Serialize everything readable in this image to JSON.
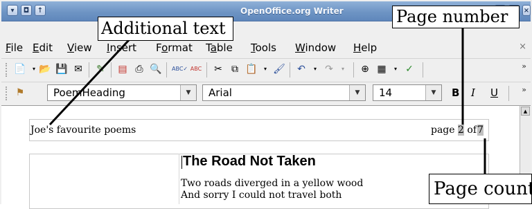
{
  "window": {
    "title": "OpenOffice.org Writer",
    "controls": [
      "menu-button",
      "close-button",
      "shade-button"
    ]
  },
  "menu": {
    "items": [
      "File",
      "Edit",
      "View",
      "Insert",
      "Format",
      "Table",
      "Tools",
      "Window",
      "Help"
    ],
    "mnemonics": [
      "F",
      "E",
      "V",
      "I",
      "o",
      "a",
      "T",
      "W",
      "H"
    ],
    "close_label": "×"
  },
  "toolbar_standard": {
    "icons": [
      "edit-file-icon",
      "open-folder-icon",
      "save-icon",
      "email-icon",
      "edit-mode-icon",
      "export-pdf-icon",
      "print-icon",
      "page-preview-icon",
      "spellcheck-icon",
      "autospellcheck-icon",
      "cut-icon",
      "copy-icon",
      "paste-icon",
      "clone-format-icon",
      "undo-icon",
      "redo-icon",
      "navigator-icon",
      "table-icon",
      "show-draw-functions-icon"
    ],
    "overflow_label": "»"
  },
  "toolbar_formatting": {
    "style_value": "PoemHeading",
    "font_value": "Arial",
    "size_value": "14",
    "bold_label": "B",
    "italic_label": "I",
    "underline_label": "U",
    "overflow_label": "»"
  },
  "document": {
    "header_left": "Joe's favourite poems",
    "header_page_prefix": "page",
    "page_number": "2",
    "header_of": "of",
    "page_count": "7",
    "heading": "The Road Not Taken",
    "lines": [
      "Two roads diverged in a yellow wood",
      "And sorry I could not travel both"
    ]
  },
  "annotations": {
    "additional_text": "Additional text",
    "page_number": "Page number",
    "page_count": "Page count"
  },
  "colors": {
    "titlebar": "#6e94c4",
    "field_shading": "#c0c0c0"
  }
}
